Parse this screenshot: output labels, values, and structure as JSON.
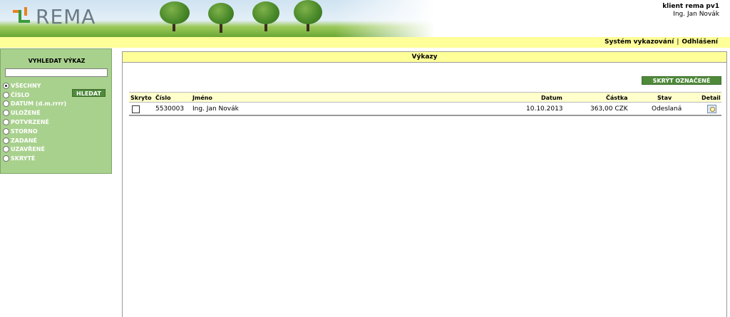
{
  "brand": {
    "logo_text": "REMA"
  },
  "user": {
    "client": "klient rema pv1",
    "name": "Ing. Jan Novák"
  },
  "topnav": {
    "system": "Systém vykazování",
    "separator": "|",
    "logout": "Odhlášení"
  },
  "sidebar": {
    "title": "VYHLEDAT VÝKAZ",
    "search_value": "",
    "search_button": "HLEDAT",
    "options": [
      {
        "label": "VŠECHNY",
        "selected": true
      },
      {
        "label": "ČÍSLO",
        "selected": false
      },
      {
        "label": "DATUM (d.m.rrrr)",
        "selected": false
      },
      {
        "label": "ULOŽENÉ",
        "selected": false
      },
      {
        "label": "POTVRZENÉ",
        "selected": false
      },
      {
        "label": "STORNO",
        "selected": false
      },
      {
        "label": "ZADANÉ",
        "selected": false
      },
      {
        "label": "UZAVŘENÉ",
        "selected": false
      },
      {
        "label": "SKRYTÉ",
        "selected": false
      }
    ]
  },
  "main": {
    "title": "Výkazy",
    "hide_button": "SKRÝT OZNAČENÉ",
    "columns": {
      "hidden": "Skryto",
      "number": "Číslo",
      "name": "Jméno",
      "date": "Datum",
      "amount": "Částka",
      "status": "Stav",
      "detail": "Detail"
    },
    "rows": [
      {
        "number": "5530003",
        "name": "Ing. Jan Novák",
        "date": "10.10.2013",
        "amount": "363,00 CZK",
        "status": "Odeslaná",
        "hidden": false
      }
    ]
  },
  "icons": {
    "detail": "magnifier-document-icon",
    "logo": "rema-logo-icon"
  },
  "colors": {
    "accent_yellow": "#ffff99",
    "green_panel": "#a9d18e",
    "green_button": "#4f8a3a"
  }
}
